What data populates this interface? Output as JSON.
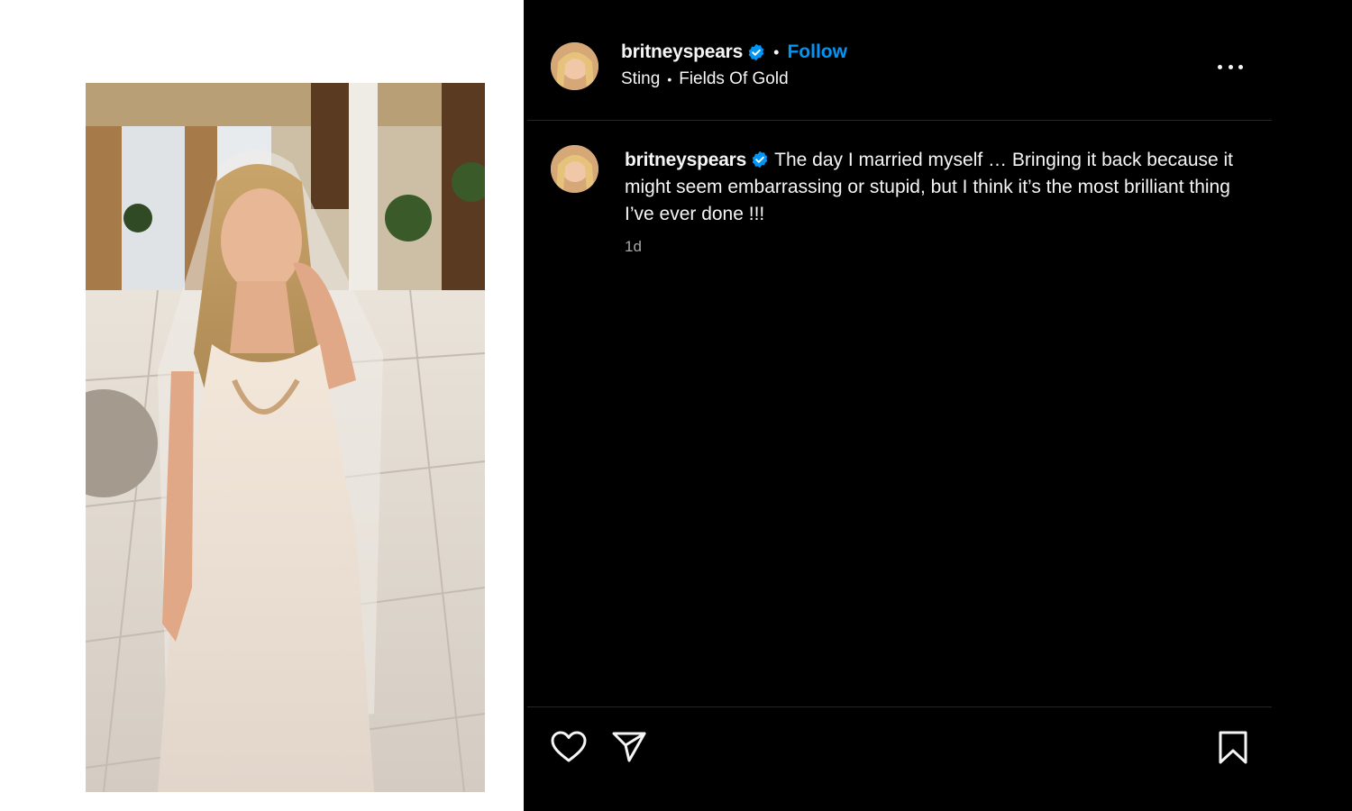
{
  "post": {
    "username": "britneyspears",
    "verified": true,
    "follow_label": "Follow",
    "separator": "•",
    "audio": {
      "artist": "Sting",
      "separator": "•",
      "track": "Fields Of Gold"
    },
    "caption": "The day I married myself … Bringing it back because it might seem embarrassing or stupid, but I think it’s the most brilliant thing I’ve ever done !!!",
    "timestamp": "1d"
  },
  "colors": {
    "panel_bg": "#000000",
    "text": "#f5f5f5",
    "follow": "#0095f6",
    "verified": "#0095f6",
    "muted": "#a8a8a8",
    "divider": "#262626"
  },
  "icons": {
    "more": "more-options-icon",
    "like": "heart-icon",
    "share": "paper-plane-icon",
    "save": "bookmark-icon",
    "verified": "verified-badge-icon"
  }
}
